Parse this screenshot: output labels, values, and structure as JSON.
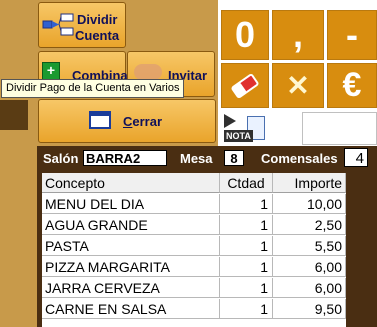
{
  "buttons": {
    "dividir_line1": "Dividir",
    "dividir_line2": "Cuenta",
    "combinar": "Combina",
    "invitar": "Invitar",
    "cerrar_first": "C",
    "cerrar_rest": "errar",
    "nota_label": "NOTA"
  },
  "keypad": {
    "zero": "0",
    "comma": ",",
    "minus": "-",
    "clear_icon": "eraser-icon",
    "cancel": "✕",
    "euro": "€"
  },
  "tooltip": {
    "text": "Dividir Pago de la Cuenta en Varios"
  },
  "info_bar": {
    "salon_label": "Salón",
    "salon_value": "BARRA2",
    "mesa_label": "Mesa",
    "mesa_value": "8",
    "comensales_label": "Comensales",
    "comensales_value": "4"
  },
  "order_table": {
    "headers": [
      "Concepto",
      "Ctdad",
      "Importe"
    ],
    "rows": [
      [
        "MENU DEL DIA",
        "1",
        "10,00"
      ],
      [
        "AGUA GRANDE",
        "1",
        "2,50"
      ],
      [
        "PASTA",
        "1",
        "5,50"
      ],
      [
        "PIZZA MARGARITA",
        "1",
        "6,00"
      ],
      [
        "JARRA CERVEZA",
        "1",
        "6,00"
      ],
      [
        "CARNE EN SALSA",
        "1",
        "9,50"
      ]
    ]
  },
  "colors": {
    "accent_orange": "#d88d0f",
    "panel_brown": "#4a2e12",
    "button_gold": "#efb440",
    "eraser_red": "#e03030",
    "cancel_yellow": "#f5c020"
  }
}
